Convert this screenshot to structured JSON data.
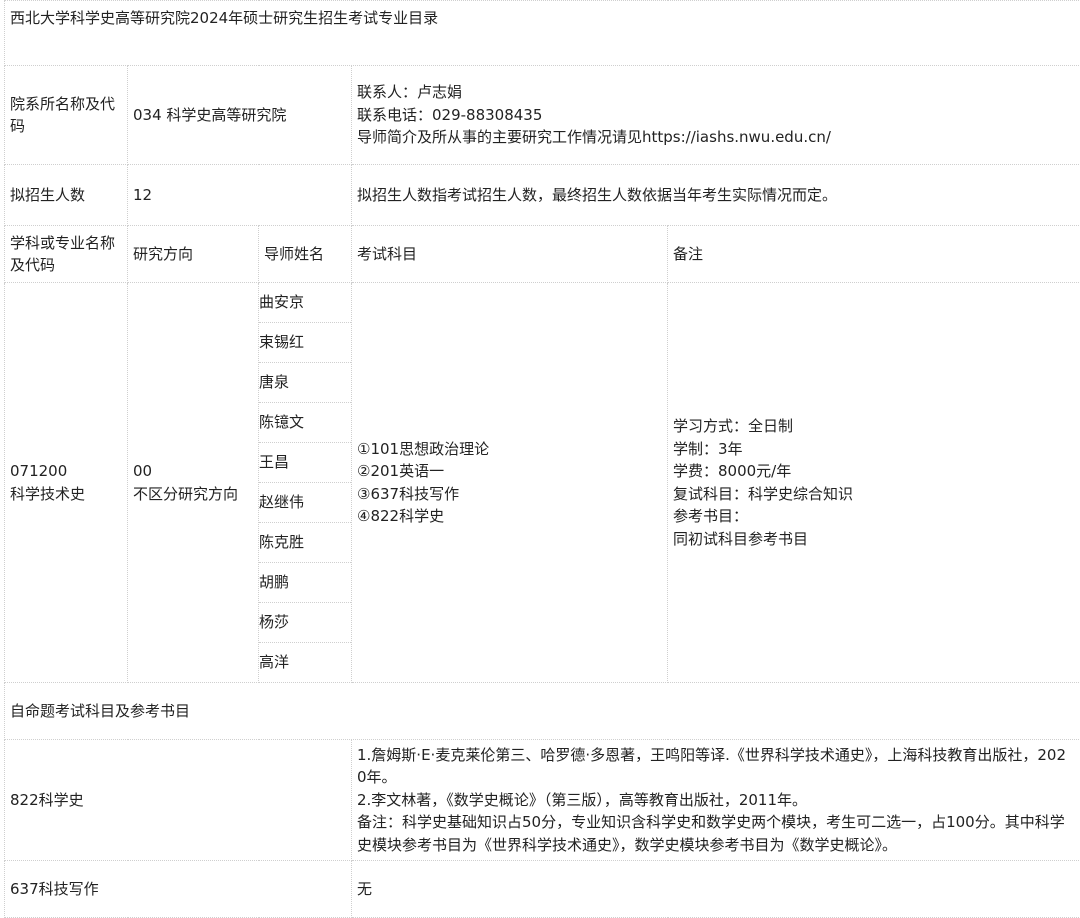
{
  "title": "西北大学科学史高等研究院2024年硕士研究生招生考试专业目录",
  "dept": {
    "label": "院系所名称及代码",
    "value": "034 科学史高等研究院",
    "contact": "联系人：卢志娟",
    "phone": "联系电话：029-88308435",
    "info": "导师简介及所从事的主要研究工作情况请见https://iashs.nwu.edu.cn/"
  },
  "enroll": {
    "label": "拟招生人数",
    "value": "12",
    "note": "拟招生人数指考试招生人数，最终招生人数依据当年考生实际情况而定。"
  },
  "headers": {
    "major": "学科或专业名称及代码",
    "direction": "研究方向",
    "tutor": "导师姓名",
    "exam": "考试科目",
    "remark": "备注"
  },
  "program": {
    "code": "071200",
    "name": "科学技术史",
    "dir_code": "00",
    "dir_name": "不区分研究方向",
    "tutors": [
      "曲安京",
      "束锡红",
      "唐泉",
      "陈镱文",
      "王昌",
      "赵继伟",
      "陈克胜",
      "胡鹏",
      "杨莎",
      "高洋"
    ],
    "exams": [
      "①101思想政治理论",
      "②201英语一",
      "③637科技写作",
      "④822科学史"
    ],
    "remarks": [
      "学习方式：全日制",
      "学制：3年",
      "学费：8000元/年",
      "复试科目：科学史综合知识",
      "参考书目：",
      "同初试科目参考书目"
    ]
  },
  "self_exam": {
    "label": "自命题考试科目及参考书目"
  },
  "subjects": [
    {
      "name": "822科学史",
      "refs": [
        "1.詹姆斯·E·麦克莱伦第三、哈罗德·多恩著，王鸣阳等译.《世界科学技术通史》，上海科技教育出版社，2020年。",
        "2.李文林著，《数学史概论》（第三版），高等教育出版社，2011年。",
        "备注：科学史基础知识占50分，专业知识含科学史和数学史两个模块，考生可二选一，占100分。其中科学史模块参考书目为《世界科学技术通史》，数学史模块参考书目为《数学史概论》。"
      ]
    },
    {
      "name": "637科技写作",
      "refs": [
        "无"
      ]
    }
  ]
}
